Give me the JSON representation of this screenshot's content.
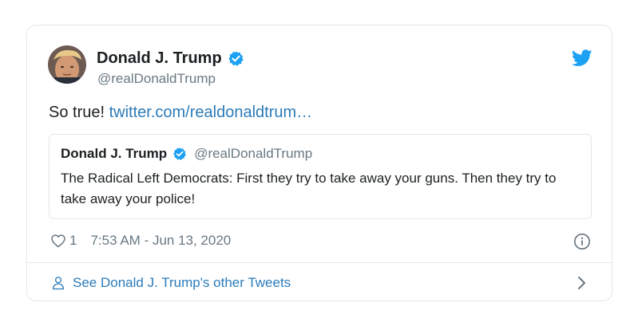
{
  "tweet": {
    "author_name": "Donald J. Trump",
    "author_handle": "@realDonaldTrump",
    "text": "So true! ",
    "link_text": "twitter.com/realdonaldtrum…",
    "like_count": "1",
    "timestamp": "7:53 AM - Jun 13, 2020"
  },
  "quote": {
    "author_name": "Donald J. Trump",
    "author_handle": "@realDonaldTrump",
    "text": "The Radical Left Democrats: First they try to take away your guns. Then they try to take away your police!"
  },
  "footer": {
    "label": "See Donald J. Trump's other Tweets"
  },
  "icons": {
    "verified": "verified-badge-icon",
    "logo": "twitter-bird-icon",
    "like": "heart-icon",
    "info": "info-icon",
    "profile": "person-icon",
    "chevron": "chevron-right-icon"
  },
  "colors": {
    "accent": "#1da1f2",
    "link": "#2b7bb9",
    "text": "#1c2022",
    "secondary": "#697882",
    "border": "#e1e8ed"
  }
}
